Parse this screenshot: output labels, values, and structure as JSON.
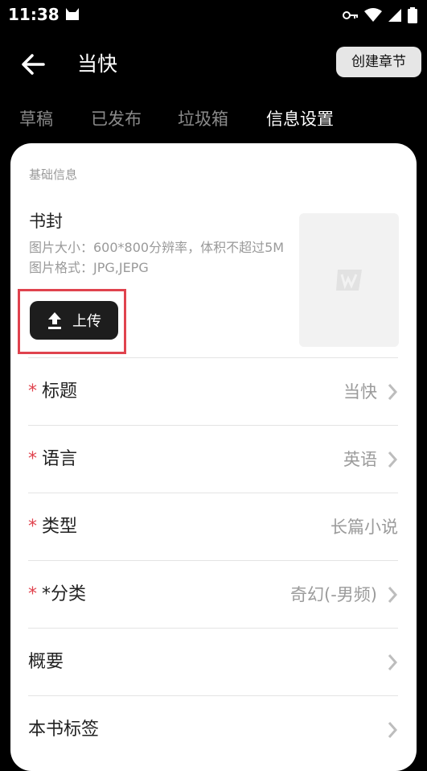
{
  "status_bar": {
    "time": "11:38"
  },
  "header": {
    "title": "当快",
    "create_button": "创建章节"
  },
  "tabs": [
    {
      "label": "草稿"
    },
    {
      "label": "已发布"
    },
    {
      "label": "垃圾箱"
    },
    {
      "label": "信息设置",
      "active": true
    }
  ],
  "section_label": "基础信息",
  "cover": {
    "title": "书封",
    "description": "图片大小：600*800分辨率，体积不超过5M 图片格式：JPG,JEPG",
    "upload_label": "上传"
  },
  "fields": [
    {
      "required": "*",
      "label": "标题",
      "value": "当快"
    },
    {
      "required": "*",
      "label": "语言",
      "value": "英语"
    },
    {
      "required": "*",
      "label": "类型",
      "value": "长篇小说"
    },
    {
      "required": "*",
      "label": "*分类",
      "value": "奇幻(-男频)"
    },
    {
      "label": "概要",
      "value": ""
    },
    {
      "label": "本书标签",
      "value": ""
    }
  ],
  "colors": {
    "accent_red": "#e0434e",
    "background": "#000000",
    "card": "#ffffff"
  }
}
